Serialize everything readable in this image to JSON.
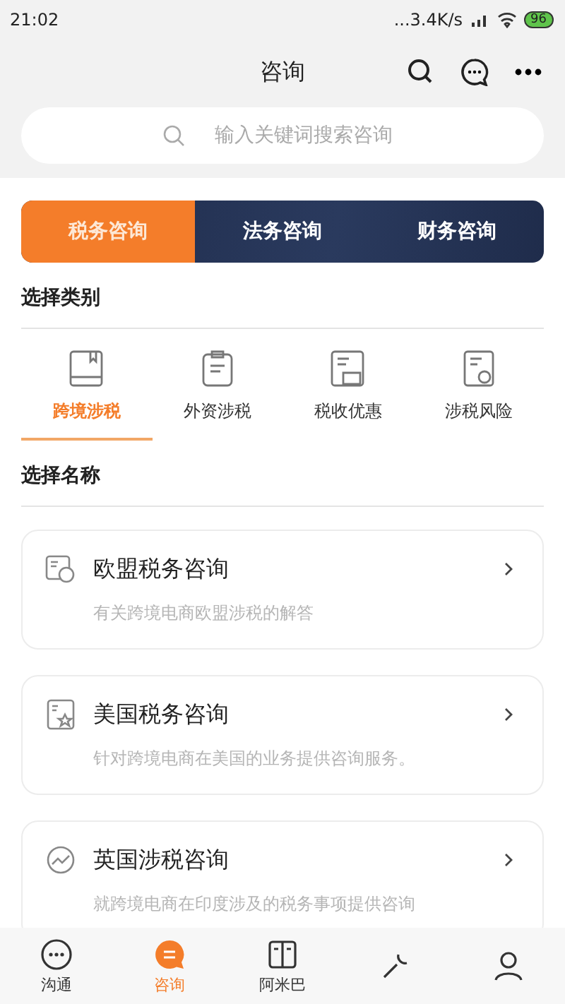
{
  "status_bar": {
    "time": "21:02",
    "network_speed": "...3.4K/s",
    "battery": "96"
  },
  "header": {
    "title": "咨询"
  },
  "search": {
    "placeholder": "输入关键词搜索咨询"
  },
  "segments": [
    {
      "label": "税务咨询",
      "selected": true
    },
    {
      "label": "法务咨询",
      "selected": false
    },
    {
      "label": "财务咨询",
      "selected": false
    }
  ],
  "category_heading": "选择类别",
  "categories": [
    {
      "label": "跨境涉税",
      "kind": "book",
      "selected": true
    },
    {
      "label": "外资涉税",
      "kind": "clipboard",
      "selected": false
    },
    {
      "label": "税收优惠",
      "kind": "ticket",
      "selected": false
    },
    {
      "label": "涉税风险",
      "kind": "shield",
      "selected": false
    }
  ],
  "name_heading": "选择名称",
  "items": [
    {
      "title": "欧盟税务咨询",
      "description": "有关跨境电商欧盟涉税的解答",
      "kind": "chat"
    },
    {
      "title": "美国税务咨询",
      "description": "针对跨境电商在美国的业务提供咨询服务。",
      "kind": "star"
    },
    {
      "title": "英国涉税咨询",
      "description": "就跨境电商在印度涉及的税务事项提供咨询",
      "kind": "trend"
    }
  ],
  "tab_bar": [
    {
      "label": "沟通",
      "kind": "chat",
      "selected": false
    },
    {
      "label": "咨询",
      "kind": "consult",
      "selected": true
    },
    {
      "label": "阿米巴",
      "kind": "book",
      "selected": false
    },
    {
      "kind": "tools",
      "selected": false
    },
    {
      "kind": "person",
      "selected": false
    }
  ]
}
